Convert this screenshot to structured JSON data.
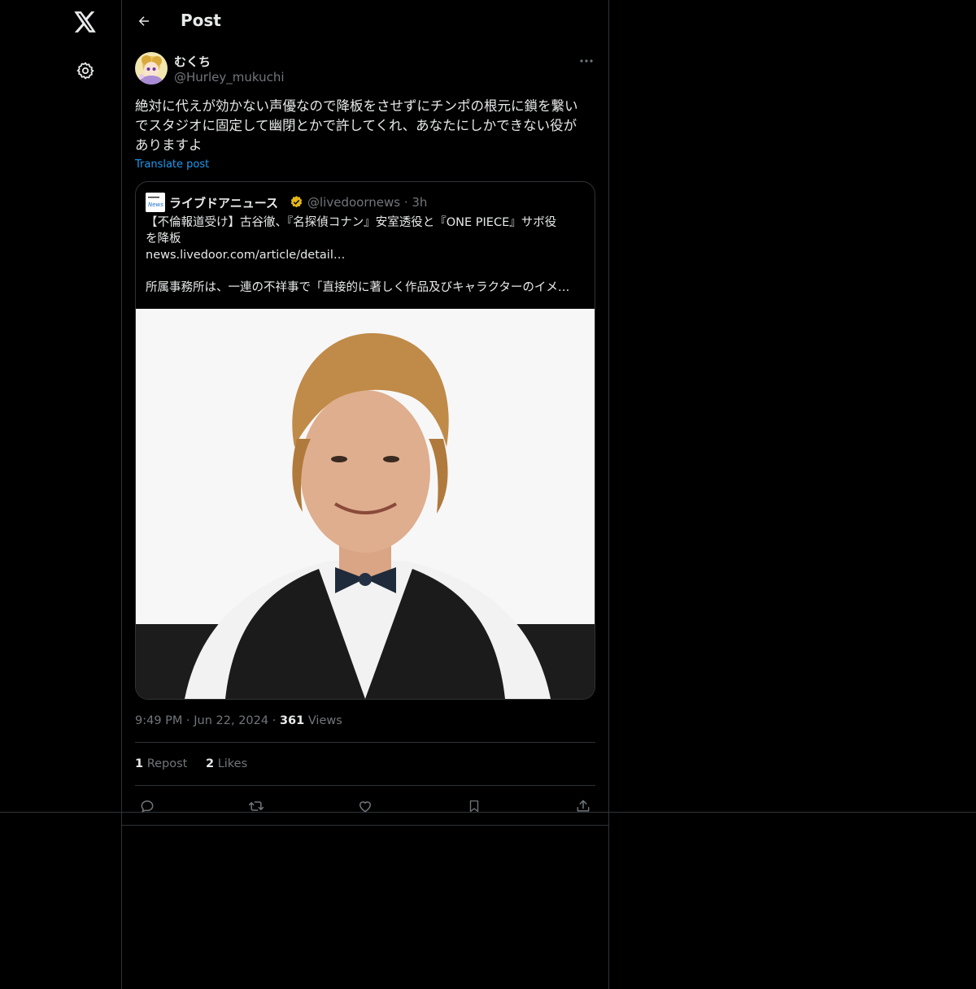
{
  "nav": {
    "logo_icon": "x-logo-icon",
    "settings_icon": "gear-icon"
  },
  "header": {
    "back_icon": "arrow-left-icon",
    "title": "Post"
  },
  "post": {
    "author": {
      "display_name": "むくち",
      "handle": "@Hurley_mukuchi",
      "avatar_icon": "avatar-image"
    },
    "text": "絶対に代えが効かない声優なので降板をさせずにチンポの根元に鎖を繋い\nでスタジオに固定して幽閉とかで許してくれ、あなたにしかできない役が\nありますよ",
    "translate_label": "Translate post",
    "quote": {
      "source_name": "ライブドアニュース",
      "source_handle": "@livedoornews",
      "time": "3h",
      "source_logo_text": "News",
      "headline_line1": "【不倫報道受け】古谷徹、『名探偵コナン』安室透役と『ONE PIECE』サボ役",
      "headline_line2": "を降板",
      "link": "news.livedoor.com/article/detail…",
      "excerpt": "所属事務所は、一連の不祥事で「直接的に著しく作品及びキャラクターのイメ…",
      "image": "photo-of-man-in-bow-tie"
    },
    "meta": {
      "time": "9:49 PM",
      "date": "Jun 22, 2024",
      "views_count": "361",
      "views_label": "Views"
    },
    "stats": {
      "reposts_count": "1",
      "reposts_label": "Repost",
      "likes_count": "2",
      "likes_label": "Likes"
    },
    "actions": [
      "reply-icon",
      "repost-icon",
      "like-icon",
      "bookmark-icon",
      "share-icon"
    ]
  },
  "colors": {
    "background": "#000000",
    "text": "#e7e9ea",
    "secondary_text": "#71767b",
    "link": "#1d9bf0",
    "border": "#2f3336",
    "verified_gold": "#e2b719"
  }
}
